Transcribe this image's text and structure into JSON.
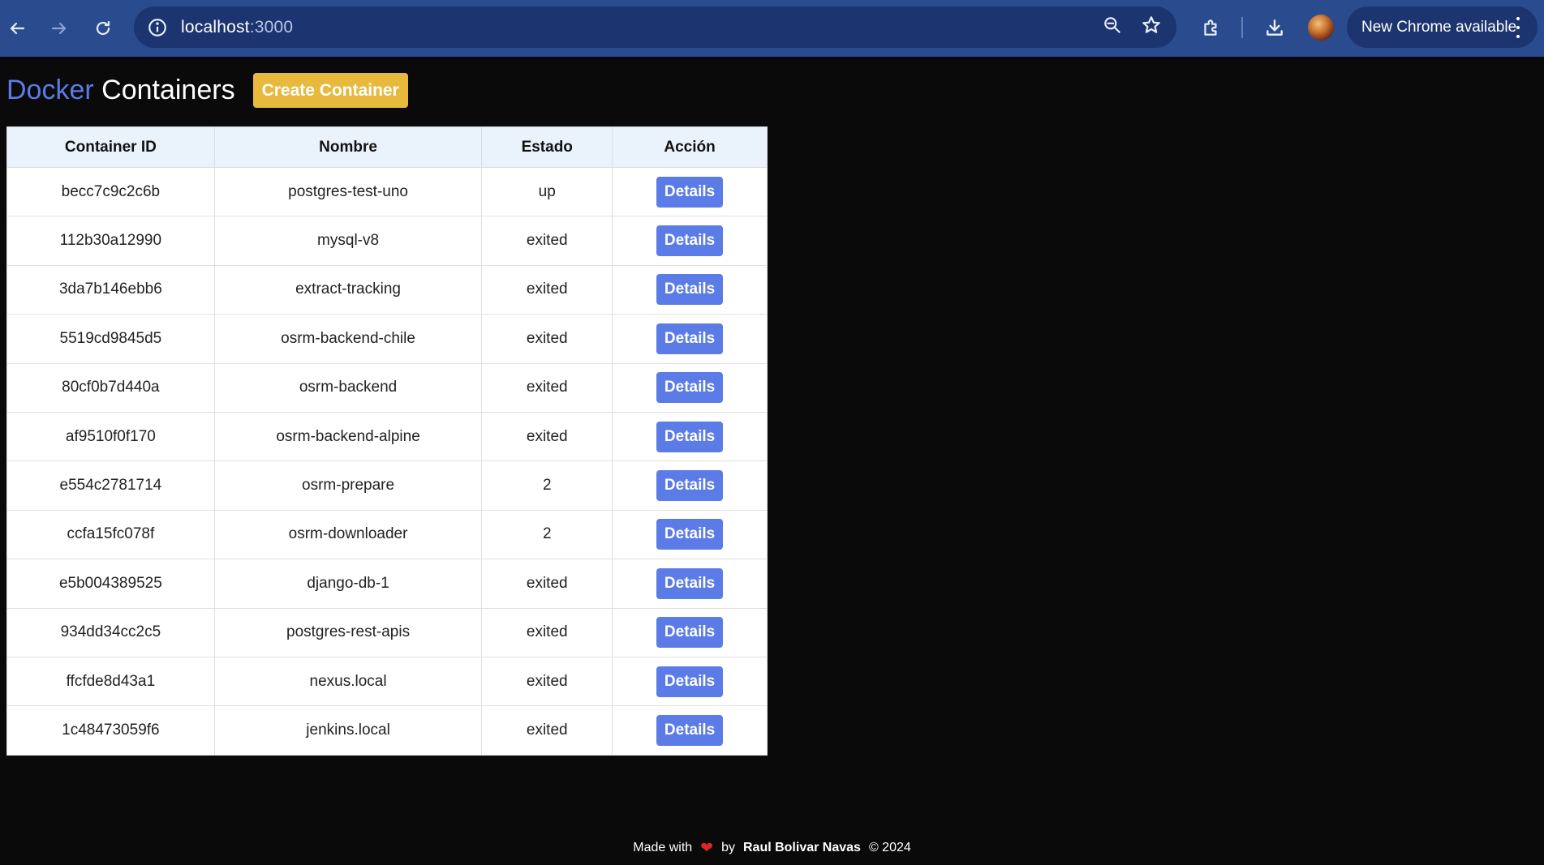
{
  "browser": {
    "url_host": "localhost",
    "url_port": ":3000",
    "update_label": "New Chrome available"
  },
  "header": {
    "title_brand": "Docker",
    "title_rest": " Containers",
    "create_label": "Create Container"
  },
  "table": {
    "columns": [
      "Container ID",
      "Nombre",
      "Estado",
      "Acción"
    ],
    "details_label": "Details",
    "rows": [
      {
        "id": "becc7c9c2c6b",
        "name": "postgres-test-uno",
        "status": "up"
      },
      {
        "id": "112b30a12990",
        "name": "mysql-v8",
        "status": "exited"
      },
      {
        "id": "3da7b146ebb6",
        "name": "extract-tracking",
        "status": "exited"
      },
      {
        "id": "5519cd9845d5",
        "name": "osrm-backend-chile",
        "status": "exited"
      },
      {
        "id": "80cf0b7d440a",
        "name": "osrm-backend",
        "status": "exited"
      },
      {
        "id": "af9510f0f170",
        "name": "osrm-backend-alpine",
        "status": "exited"
      },
      {
        "id": "e554c2781714",
        "name": "osrm-prepare",
        "status": "2"
      },
      {
        "id": "ccfa15fc078f",
        "name": "osrm-downloader",
        "status": "2"
      },
      {
        "id": "e5b004389525",
        "name": "django-db-1",
        "status": "exited"
      },
      {
        "id": "934dd34cc2c5",
        "name": "postgres-rest-apis",
        "status": "exited"
      },
      {
        "id": "ffcfde8d43a1",
        "name": "nexus.local",
        "status": "exited"
      },
      {
        "id": "1c48473059f6",
        "name": "jenkins.local",
        "status": "exited"
      }
    ]
  },
  "footer": {
    "made_with": "Made with",
    "by": "by",
    "author": "Raul Bolivar Navas",
    "copyright": "© 2024"
  },
  "colors": {
    "accent": "#5b7be6",
    "create_button": "#e7b93d",
    "background": "#0a0a0a",
    "chrome": "#2a4b8d"
  },
  "icons": [
    "arrow-left-icon",
    "arrow-right-icon",
    "reload-icon",
    "info-icon",
    "zoom-icon",
    "star-icon",
    "extensions-icon",
    "download-icon",
    "kebab-menu-icon",
    "heart-icon"
  ]
}
